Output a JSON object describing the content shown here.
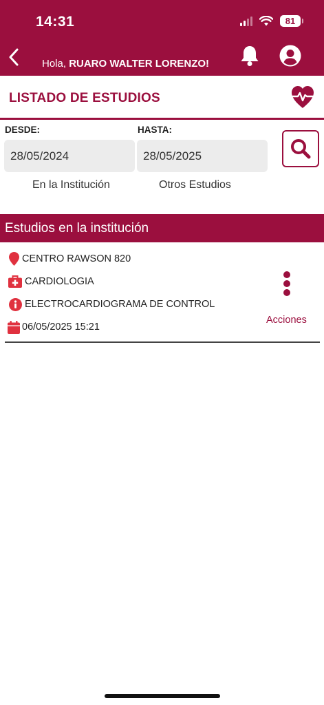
{
  "status_bar": {
    "time": "14:31",
    "battery": "81"
  },
  "header": {
    "greeting_prefix": "Hola, ",
    "user_name": "RUARO WALTER LORENZO!",
    "back_icon": "chevron-left-icon",
    "bell_icon": "bell-icon",
    "user_icon": "user-circle-icon"
  },
  "page": {
    "title": "LISTADO DE ESTUDIOS",
    "title_icon": "heart-pulse-icon"
  },
  "filters": {
    "from_label": "DESDE:",
    "from_value": "28/05/2024",
    "to_label": "HASTA:",
    "to_value": "28/05/2025",
    "search_icon": "search-icon"
  },
  "tabs": [
    {
      "label": "En la Institución"
    },
    {
      "label": "Otros Estudios"
    }
  ],
  "section": {
    "title": "Estudios en la institución"
  },
  "studies": [
    {
      "location": "CENTRO RAWSON 820",
      "specialty": "CARDIOLOGIA",
      "study": "ELECTROCARDIOGRAMA DE CONTROL",
      "datetime": "06/05/2025 15:21",
      "actions_label": "Acciones"
    }
  ],
  "colors": {
    "brand": "#9b0f3e",
    "accent_icon": "#e0313f"
  }
}
